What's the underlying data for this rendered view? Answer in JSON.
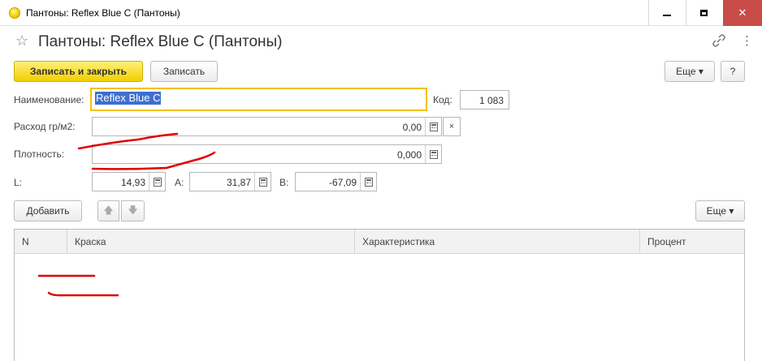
{
  "window": {
    "title": "Пантоны: Reflex Blue C (Пантоны)",
    "close_glyph": "✕"
  },
  "form": {
    "title": "Пантоны: Reflex Blue C (Пантоны)",
    "star_glyph": "☆",
    "kebab_glyph": "⋮"
  },
  "toolbar": {
    "save_close_label": "Записать и закрыть",
    "save_label": "Записать",
    "more_label": "Еще ▾",
    "help_label": "?"
  },
  "fields": {
    "name_label": "Наименование:",
    "name_value": "Reflex Blue C",
    "code_label": "Код:",
    "code_value": "1 083",
    "consumption_label": "Расход гр/м2:",
    "consumption_value": "0,00",
    "clear_glyph": "×",
    "density_label": "Плотность:",
    "density_value": "0,000",
    "l_label": "L:",
    "l_value": "14,93",
    "a_label": "A:",
    "a_value": "31,87",
    "b_label": "B:",
    "b_value": "-67,09"
  },
  "table_toolbar": {
    "add_label": "Добавить",
    "up_glyph": "🡅",
    "down_glyph": "🡇",
    "more_label": "Еще ▾"
  },
  "table": {
    "columns": [
      "N",
      "Краска",
      "Характеристика",
      "Процент"
    ]
  },
  "colors": {
    "accent_yellow": "#f2cf00",
    "focus_border": "#f2c100",
    "selection_blue": "#3d6fd1",
    "annotation_red": "#e00000",
    "close_red": "#c84c47"
  }
}
